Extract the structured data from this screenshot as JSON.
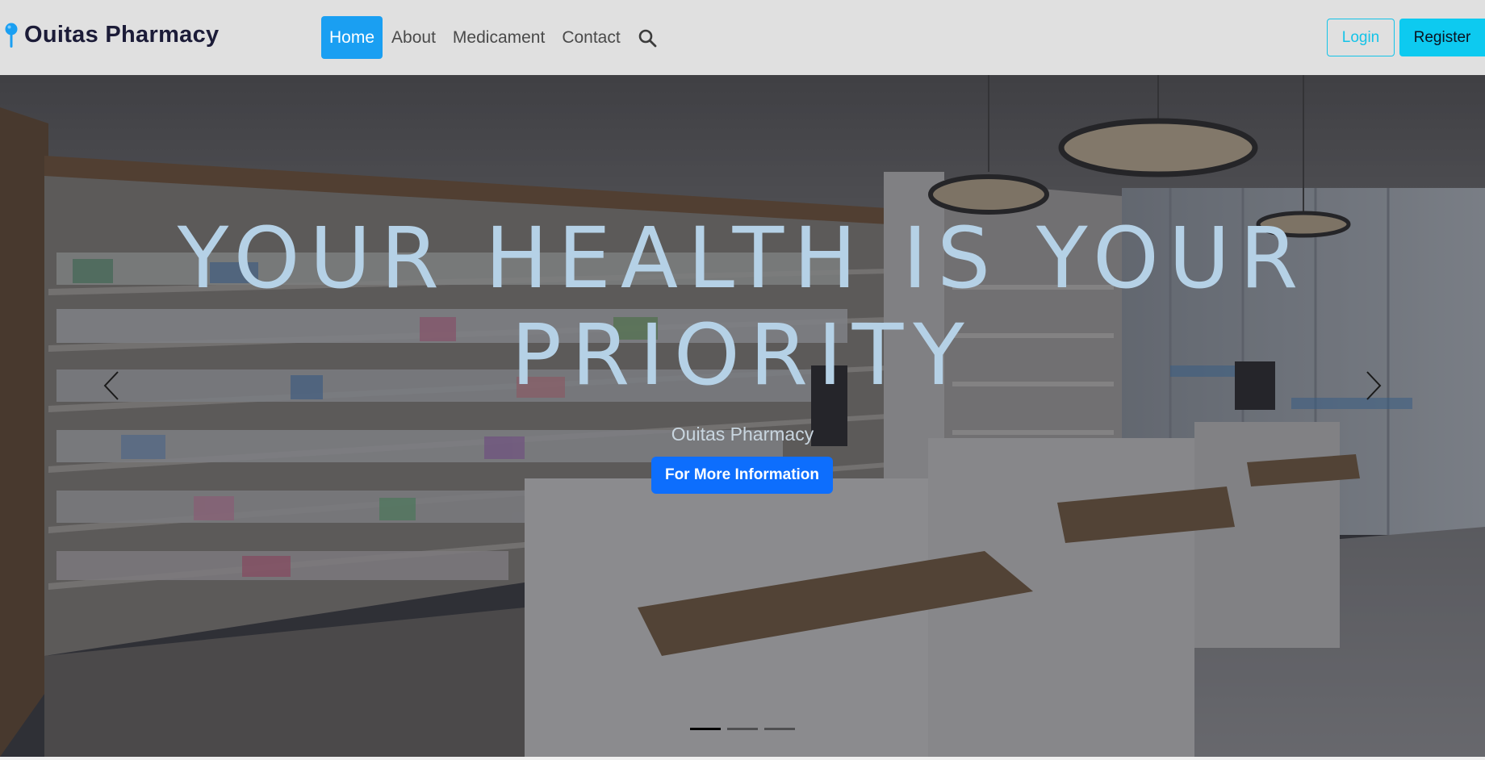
{
  "navbar": {
    "brand": "Ouitas Pharmacy",
    "links": [
      {
        "label": "Home",
        "active": true
      },
      {
        "label": "About",
        "active": false
      },
      {
        "label": "Medicament",
        "active": false
      },
      {
        "label": "Contact",
        "active": false
      }
    ],
    "search_icon": "search-icon",
    "login_label": "Login",
    "register_label": "Register"
  },
  "hero": {
    "headline": "YOUR HEALTH IS YOUR PRIORITY",
    "subtitle": "Ouitas Pharmacy",
    "cta_label": "For More Information",
    "slide_count": 3,
    "active_slide": 1
  },
  "colors": {
    "nav_bg": "#e0e0e0",
    "brand": "#1c1c38",
    "nav_active_bg": "#1a9ff2",
    "login_outline": "#13c3e8",
    "register_bg": "#0dcaf0",
    "headline": "#b5d1e6",
    "cta_bg": "#0d6efd"
  }
}
